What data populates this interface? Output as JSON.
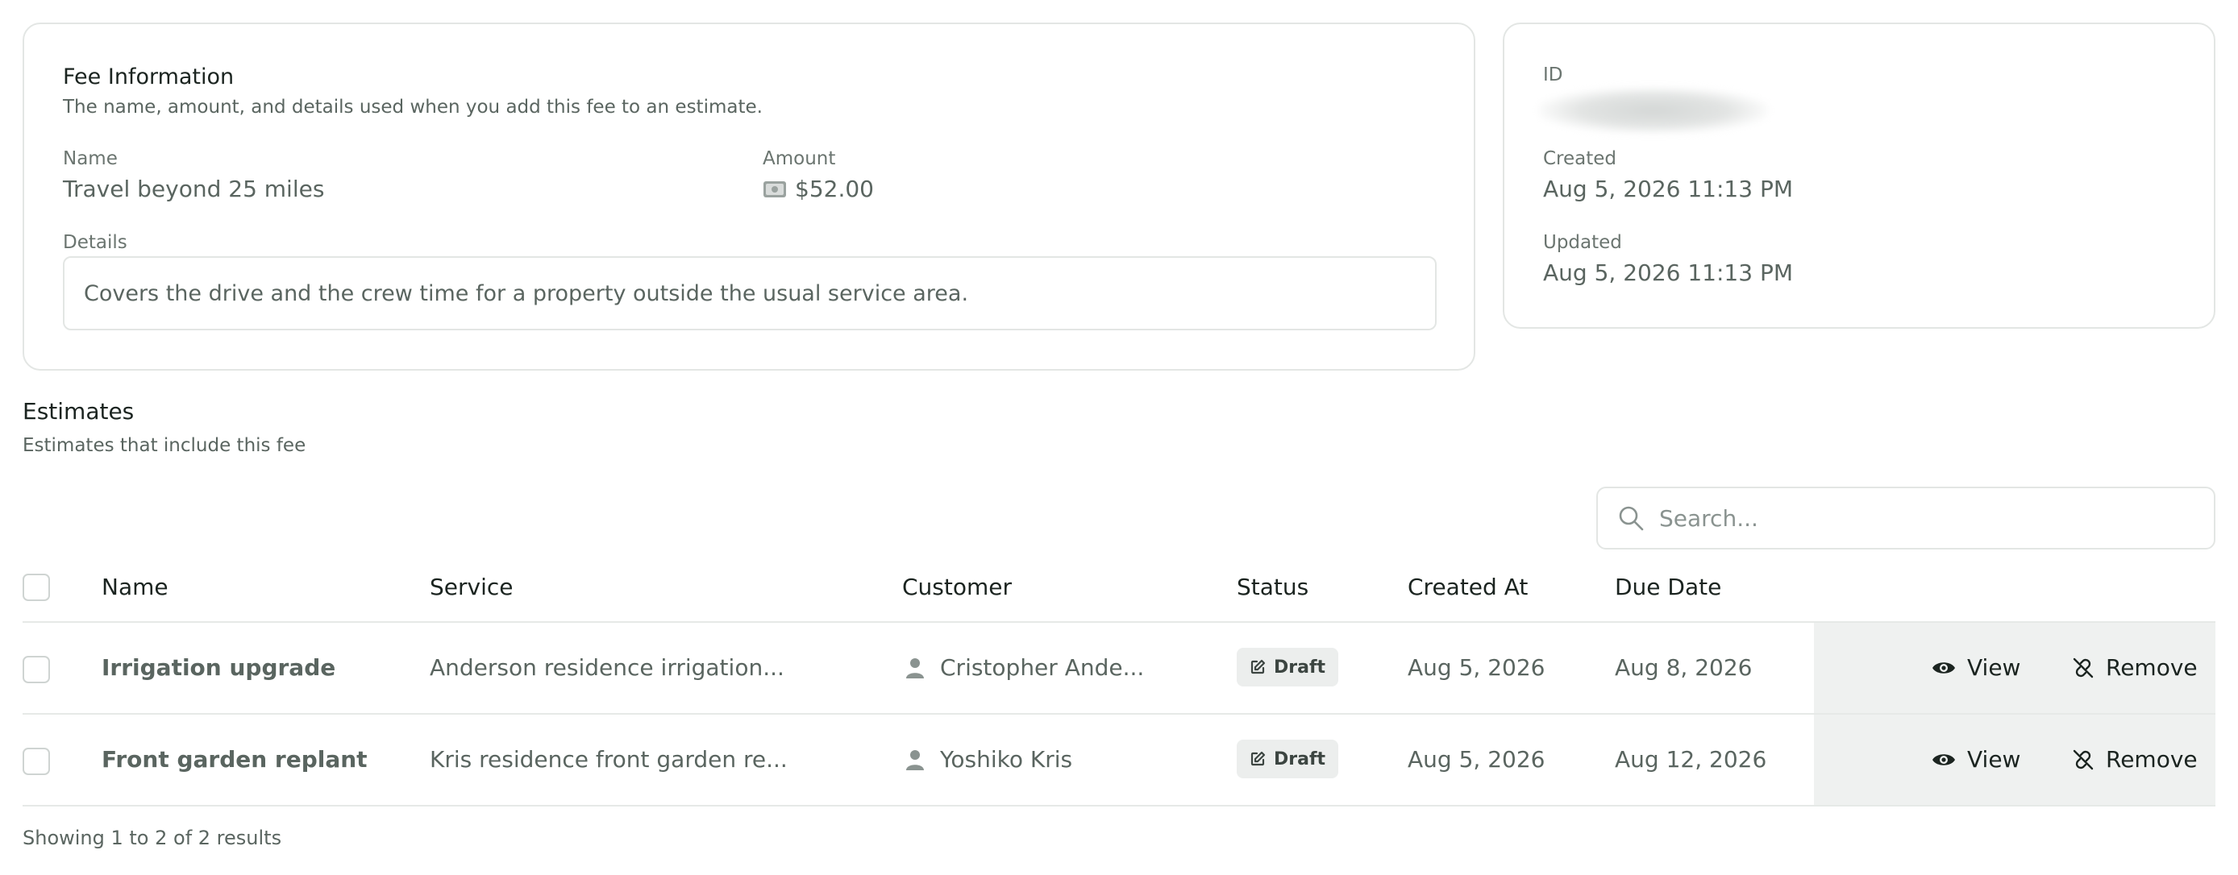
{
  "fee": {
    "title": "Fee Information",
    "description": "The name, amount, and details used when you add this fee to an estimate.",
    "name_label": "Name",
    "name_value": "Travel beyond 25 miles",
    "amount_label": "Amount",
    "amount_value": "$52.00",
    "details_label": "Details",
    "details_value": "Covers the drive and the crew time for a property outside the usual service area."
  },
  "meta": {
    "id_label": "ID",
    "created_label": "Created",
    "created_value": "Aug 5, 2026 11:13 PM",
    "updated_label": "Updated",
    "updated_value": "Aug 5, 2026 11:13 PM"
  },
  "estimates": {
    "title": "Estimates",
    "description": "Estimates that include this fee",
    "search_placeholder": "Search...",
    "columns": {
      "name": "Name",
      "service": "Service",
      "customer": "Customer",
      "status": "Status",
      "created_at": "Created At",
      "due_date": "Due Date"
    },
    "rows": [
      {
        "name": "Irrigation upgrade",
        "service": "Anderson residence irrigation...",
        "customer": "Cristopher Ande...",
        "status": "Draft",
        "created_at": "Aug 5, 2026",
        "due_date": "Aug 8, 2026",
        "view_label": "View",
        "remove_label": "Remove"
      },
      {
        "name": "Front garden replant",
        "service": "Kris residence front garden re...",
        "customer": "Yoshiko Kris",
        "status": "Draft",
        "created_at": "Aug 5, 2026",
        "due_date": "Aug 12, 2026",
        "view_label": "View",
        "remove_label": "Remove"
      }
    ],
    "footer": "Showing 1 to 2 of 2 results"
  },
  "icons": {
    "amount": "money-icon",
    "search": "search-icon",
    "customer": "user-icon",
    "status": "edit-icon",
    "view": "eye-icon",
    "remove": "unlink-icon"
  }
}
